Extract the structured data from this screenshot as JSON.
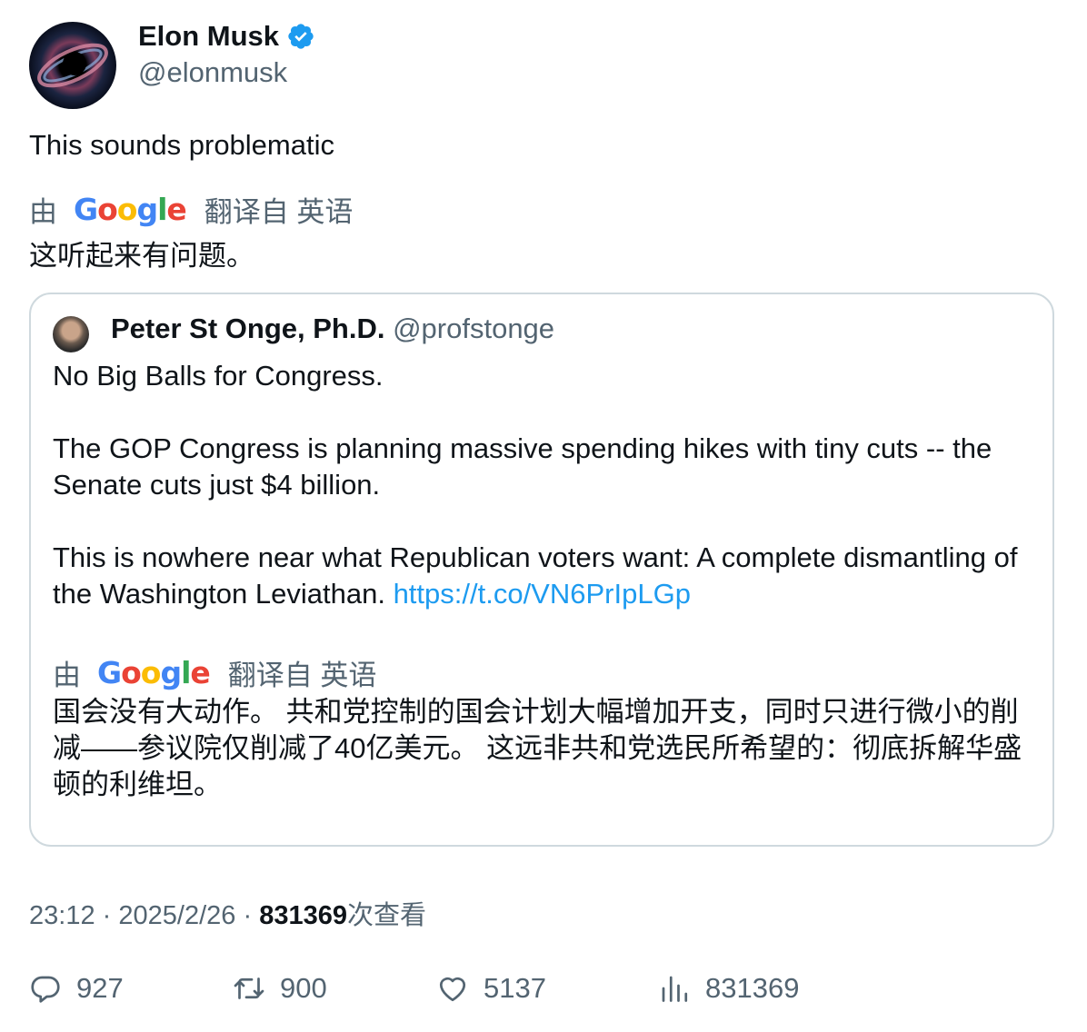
{
  "author": {
    "name": "Elon Musk",
    "handle": "@elonmusk",
    "verified_color": "#1d9bf0"
  },
  "tweet": {
    "text": "This sounds problematic",
    "translation": {
      "by": "由",
      "provider": "Google",
      "from": "翻译自 英语",
      "text": "这听起来有问题。"
    }
  },
  "quote": {
    "name": "Peter St Onge, Ph.D.",
    "handle": "@profstonge",
    "paragraphs": [
      "No Big Balls for Congress.",
      "The GOP Congress is planning massive spending hikes with tiny cuts -- the Senate cuts just $4 billion.",
      "This is nowhere near what Republican voters want: A complete dismantling of the Washington Leviathan."
    ],
    "link": "https://t.co/VN6PrIpLGp",
    "translation": {
      "by": "由",
      "provider": "Google",
      "from": "翻译自 英语",
      "text": "国会没有大动作。 共和党控制的国会计划大幅增加开支，同时只进行微小的削减——参议院仅削减了40亿美元。 这远非共和党选民所希望的：彻底拆解华盛顿的利维坦。"
    }
  },
  "meta": {
    "time": "23:12",
    "separator": "·",
    "date": "2025/2/26",
    "views": "831369",
    "views_label": "次查看"
  },
  "actions": {
    "replies": "927",
    "retweets": "900",
    "likes": "5137",
    "views": "831369"
  }
}
